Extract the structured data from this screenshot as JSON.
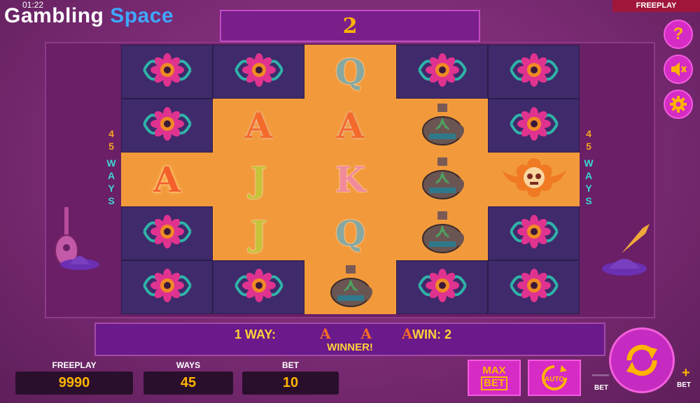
{
  "status": {
    "time": "01:22"
  },
  "brand": {
    "part1": "Gambling",
    "part2": "Space"
  },
  "mode_badge": "FREEPLAY",
  "counter": {
    "value": "2"
  },
  "side_buttons": [
    {
      "icon": "help-icon",
      "glyph": "?"
    },
    {
      "icon": "sound-muted-icon"
    },
    {
      "icon": "gear-icon"
    }
  ],
  "ways_label": {
    "number": [
      "4",
      "5"
    ],
    "word": [
      "W",
      "A",
      "Y",
      "S"
    ]
  },
  "reels": [
    [
      "flower",
      "flower",
      "A",
      "flower",
      "flower"
    ],
    [
      "flower",
      "A",
      "J",
      "J",
      "flower"
    ],
    [
      "Q",
      "A",
      "K",
      "Q",
      "tequila"
    ],
    [
      "flower",
      "tequila",
      "tequila",
      "tequila",
      "flower"
    ],
    [
      "flower",
      "flower",
      "skull",
      "flower",
      "flower"
    ]
  ],
  "win": {
    "ways_text": "1 WAY:",
    "symbols": "A A A",
    "amount_text": "WIN: 2",
    "message": "WINNER!"
  },
  "stats": {
    "freeplay": {
      "label": "FREEPLAY",
      "value": "9990"
    },
    "ways": {
      "label": "WAYS",
      "value": "45"
    },
    "bet": {
      "label": "BET",
      "value": "10"
    }
  },
  "buttons": {
    "max_bet": {
      "line1": "MAX",
      "line2": "BET"
    },
    "auto": "AUTO",
    "bet_minus": "BET",
    "bet_plus": "BET"
  },
  "colors": {
    "accent": "#ffb400",
    "button": "#d62bc4",
    "panel": "#6a1a8a",
    "lit_cell": "#f29a3b",
    "dim_cell": "#3f2a6b"
  }
}
